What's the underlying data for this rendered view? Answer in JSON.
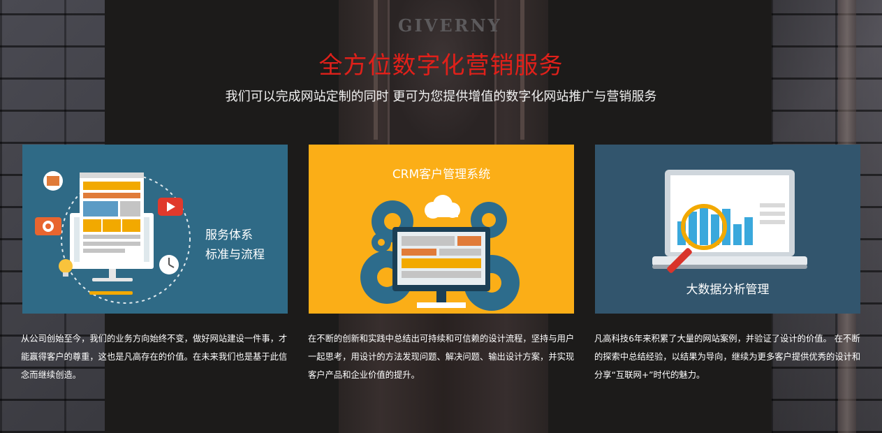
{
  "background": {
    "sign_text": "GIVERNY"
  },
  "header": {
    "title": "全方位数字化营销服务",
    "subtitle": "我们可以完成网站定制的同时 更可为您提供增值的数字化网站推广与营销服务"
  },
  "cards": [
    {
      "label_line1": "服务体系",
      "label_line2": "标准与流程",
      "description": "从公司创始至今，我们的业务方向始终不变，做好网站建设一件事，才能赢得客户的尊重，这也是凡高存在的价值。在未来我们也是基于此信念而继续创造。",
      "bg_color": "#2f6a86",
      "icons": [
        "browser-window-icon",
        "youtube-play-icon",
        "camera-icon",
        "lightbulb-icon",
        "clock-icon",
        "image-icon",
        "monitor-icon"
      ]
    },
    {
      "label": "CRM客户管理系统",
      "description": "在不断的创新和实践中总结出可持续和可信赖的设计流程，坚持与用户一起思考，用设计的方法发现问题、解决问题、输出设计方案，并实现客户产品和企业价值的提升。",
      "bg_color": "#fbae17",
      "icons": [
        "gear-icon",
        "cloud-icon",
        "monitor-icon"
      ]
    },
    {
      "label": "大数据分析管理",
      "description": "凡高科技6年来积累了大量的网站案例，并验证了设计的价值。 在不断的探索中总结经验，以结果为导向，继续为更多客户提供优秀的设计和分享“互联网+”时代的魅力。",
      "bg_color": "#32556d",
      "icons": [
        "laptop-icon",
        "magnifier-icon",
        "bar-chart-icon"
      ]
    }
  ]
}
